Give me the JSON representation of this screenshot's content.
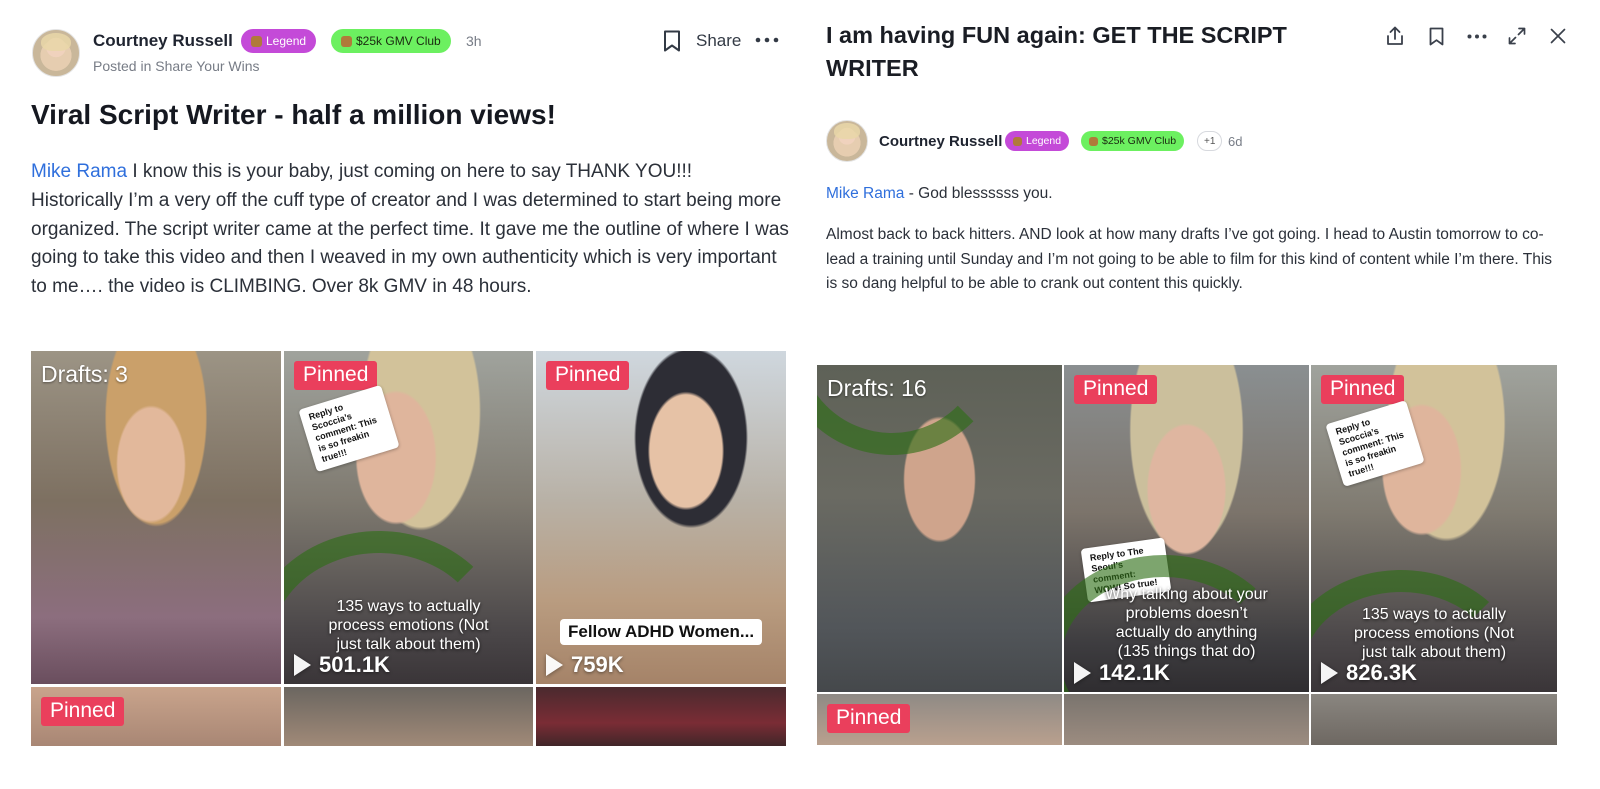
{
  "left_post": {
    "author": "Courtney Russell",
    "badges": [
      "Legend",
      "$25k GMV Club"
    ],
    "time": "3h",
    "posted_in": "Posted in Share Your Wins",
    "share_label": "Share",
    "title": "Viral Script Writer - half a million views!",
    "mention": "Mike Rama",
    "body": " I know this is your baby, just coming on here to say THANK YOU!!! Historically I’m a very off the cuff type of creator and I was determined to start being more organized. The script writer came at the perfect time. It gave me the outline of where I was going to take this video and then I weaved in my own authenticity which is very important to me…. the video is CLIMBING. Over 8k GMV in 48 hours.",
    "tiles": [
      {
        "label": "Drafts: 3"
      },
      {
        "pinned": "Pinned",
        "sticker": "Reply to Scoccia’s comment: This is so freakin true!!!",
        "caption": "135 ways to actually process emotions (Not just talk about them)",
        "views": "501.1K"
      },
      {
        "pinned": "Pinned",
        "caption_box": "Fellow ADHD Women...",
        "views": "759K"
      },
      {
        "pinned": "Pinned"
      },
      {},
      {}
    ]
  },
  "right_post": {
    "title": "I am having FUN again: GET THE SCRIPT WRITER",
    "author": "Courtney Russell",
    "badges": [
      "Legend",
      "$25k GMV Club"
    ],
    "extra_badges": "+1",
    "time": "6d",
    "mention": "Mike Rama",
    "mention_suffix": " - God blessssss you.",
    "body": "Almost back to back hitters. AND look at how many drafts I’ve got going. I head to Austin tomorrow to co-lead a training until Sunday and I’m not going to be able to film for this kind of content while I’m there. This is so dang helpful to be able to crank out content this quickly.",
    "tiles": [
      {
        "label": "Drafts: 16"
      },
      {
        "pinned": "Pinned",
        "sticker": "Reply to The Seoul’s comment: WOW! So true!",
        "caption": "Why talking about your problems doesn’t actually do anything (135 things that do)",
        "views": "142.1K"
      },
      {
        "pinned": "Pinned",
        "sticker": "Reply to Scoccia’s comment: This is so freakin true!!!",
        "caption": "135 ways to actually process emotions (Not just talk about them)",
        "views": "826.3K"
      },
      {
        "pinned": "Pinned"
      },
      {},
      {}
    ]
  },
  "icons": {
    "left_toolbar": [
      "bookmark-icon",
      "more-horizontal-icon"
    ],
    "right_toolbar": [
      "share-icon",
      "bookmark-icon",
      "more-horizontal-icon",
      "expand-icon",
      "close-icon"
    ]
  },
  "colors": {
    "mention": "#2f6fdc",
    "legend_badge": "#c44ad8",
    "gmv_badge": "#6cf060",
    "pinned": "#ea3f5c"
  }
}
